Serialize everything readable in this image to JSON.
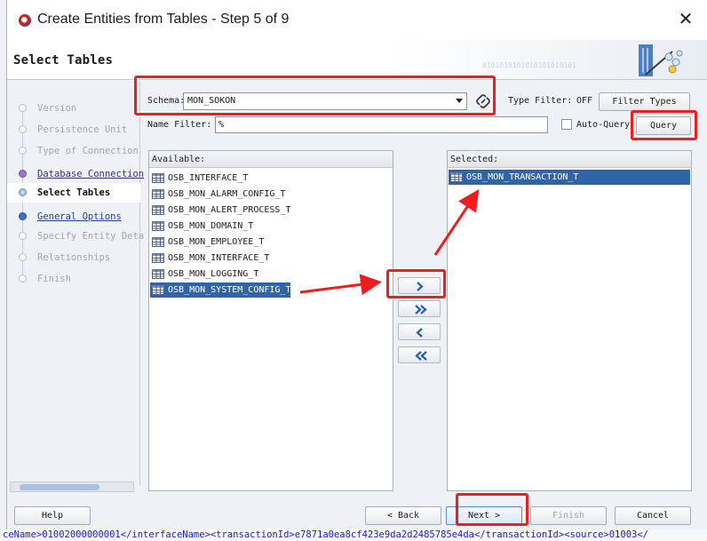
{
  "window": {
    "title": "Create Entities from Tables - Step 5 of 9",
    "close_glyph": "✕"
  },
  "header": {
    "title": "Select Tables",
    "binary_text": "0101010101010101010101"
  },
  "nav": {
    "items": [
      {
        "label": "Version",
        "state": "disabled"
      },
      {
        "label": "Persistence Unit",
        "state": "disabled"
      },
      {
        "label": "Type of Connection",
        "state": "disabled"
      },
      {
        "label": "Database Connection",
        "state": "done"
      },
      {
        "label": "Select Tables",
        "state": "current"
      },
      {
        "label": "General Options",
        "state": "link"
      },
      {
        "label": "Specify Entity Deta",
        "state": "disabled"
      },
      {
        "label": "Relationships",
        "state": "disabled"
      },
      {
        "label": "Finish",
        "state": "disabled"
      }
    ]
  },
  "form": {
    "schema_label": "Schema:",
    "schema_value": "MON_SOKON",
    "type_filter_label": "Type Filter:",
    "type_filter_value": "OFF",
    "filter_types_button": "Filter Types",
    "name_filter_label": "Name Filter:",
    "name_filter_value": "%",
    "auto_query_label": "Auto-Query",
    "query_button": "Query"
  },
  "available": {
    "header": "Available:",
    "items": [
      "OSB_INTERFACE_T",
      "OSB_MON_ALARM_CONFIG_T",
      "OSB_MON_ALERT_PROCESS_T",
      "OSB_MON_DOMAIN_T",
      "OSB_MON_EMPLOYEE_T",
      "OSB_MON_INTERFACE_T",
      "OSB_MON_LOGGING_T",
      "OSB_MON_SYSTEM_CONFIG_T"
    ],
    "selected_index": 7
  },
  "selected": {
    "header": "Selected:",
    "items": [
      "OSB_MON_TRANSACTION_T"
    ]
  },
  "footer": {
    "help": "Help",
    "back": "< Back",
    "next": "Next >",
    "finish": "Finish",
    "cancel": "Cancel"
  },
  "background": {
    "editor_line": "ceName>01002000000001</interfaceName><transactionId>e7871a0ea8cf423e9da2d2485785e4da</transactionId><source>01003</"
  },
  "colors": {
    "annotation": "#ef1d1d",
    "selection": "#2f65a8"
  }
}
